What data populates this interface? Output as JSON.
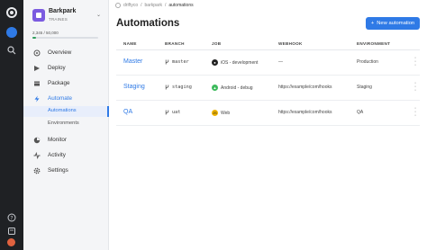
{
  "breadcrumb": {
    "items": [
      "driftyco",
      "barkpark",
      "automations"
    ]
  },
  "team": {
    "name": "Barkpark",
    "sub": "TRAINES",
    "usage": "2,345 / 50,000",
    "usage_fraction": 0.05
  },
  "nav": {
    "overview": "Overview",
    "deploy": "Deploy",
    "package": "Package",
    "automate": "Automate",
    "automations": "Automations",
    "environments": "Environments",
    "monitor": "Monitor",
    "activity": "Activity",
    "settings": "Settings"
  },
  "main": {
    "title": "Automations",
    "new_button": "New automation",
    "columns": {
      "name": "NAME",
      "branch": "BRANCH",
      "job": "JOB",
      "webhook": "WEBHOOK",
      "environment": "ENVIRONMENT"
    },
    "rows": [
      {
        "name": "Master",
        "branch": "master",
        "job": "iOS - development",
        "job_color": "#222222",
        "webhook": "—",
        "environment": "Production"
      },
      {
        "name": "Staging",
        "branch": "staging",
        "job": "Android - debug",
        "job_color": "#3dba5c",
        "webhook": "https://example/com/hooks",
        "environment": "Staging"
      },
      {
        "name": "QA",
        "branch": "uat",
        "job": "Web",
        "job_color": "#f0b400",
        "webhook": "https://example/com/hooks",
        "environment": "QA"
      }
    ]
  },
  "colors": {
    "accent": "#2f7ae6",
    "rail": "#1f2124",
    "purple": "#7b5be0"
  }
}
